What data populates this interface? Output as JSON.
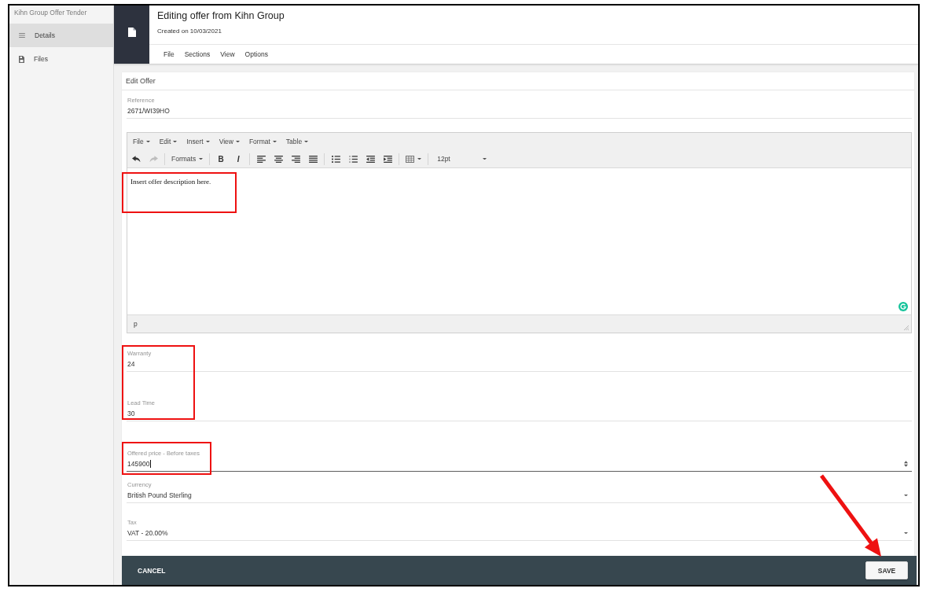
{
  "sidebar": {
    "title": "Kihn Group Offer Tender",
    "items": [
      {
        "label": "Details",
        "selected": true
      },
      {
        "label": "Files",
        "selected": false
      }
    ]
  },
  "header": {
    "title": "Editing offer from Kihn Group",
    "subtitle": "Created on 10/03/2021",
    "menu": [
      "File",
      "Sections",
      "View",
      "Options"
    ]
  },
  "form": {
    "title": "Edit Offer",
    "reference": {
      "label": "Reference",
      "value": "2671/WI39HO",
      "focused": false
    },
    "editor": {
      "menu": [
        "File",
        "Edit",
        "Insert",
        "View",
        "Format",
        "Table"
      ],
      "toolbar": {
        "undo": {
          "disabled": false
        },
        "redo": {
          "disabled": true
        },
        "formats": "Formats",
        "bold": "B",
        "italic": "I",
        "font_size": "12pt"
      },
      "content": "Insert offer description here.",
      "content_annotated": true,
      "path": "p"
    },
    "field_groups": [
      {
        "annotated": true,
        "fields": [
          {
            "kind": "text",
            "label": "Warranty",
            "value": "24",
            "focused": false
          },
          {
            "kind": "text",
            "label": "Lead Time",
            "value": "30",
            "focused": false
          }
        ]
      },
      {
        "annotated": true,
        "fields": [
          {
            "kind": "number",
            "label": "Offered price - Before taxes",
            "value": "145900",
            "focused": true
          }
        ]
      },
      {
        "annotated": false,
        "fields": [
          {
            "kind": "select",
            "label": "Currency",
            "value": "British Pound Sterling",
            "focused": false
          },
          {
            "kind": "select",
            "label": "Tax",
            "value": "VAT - 20.00%",
            "focused": false
          }
        ]
      }
    ]
  },
  "footer": {
    "cancel": "CANCEL",
    "save": {
      "label": "SAVE",
      "annotated": true
    }
  }
}
